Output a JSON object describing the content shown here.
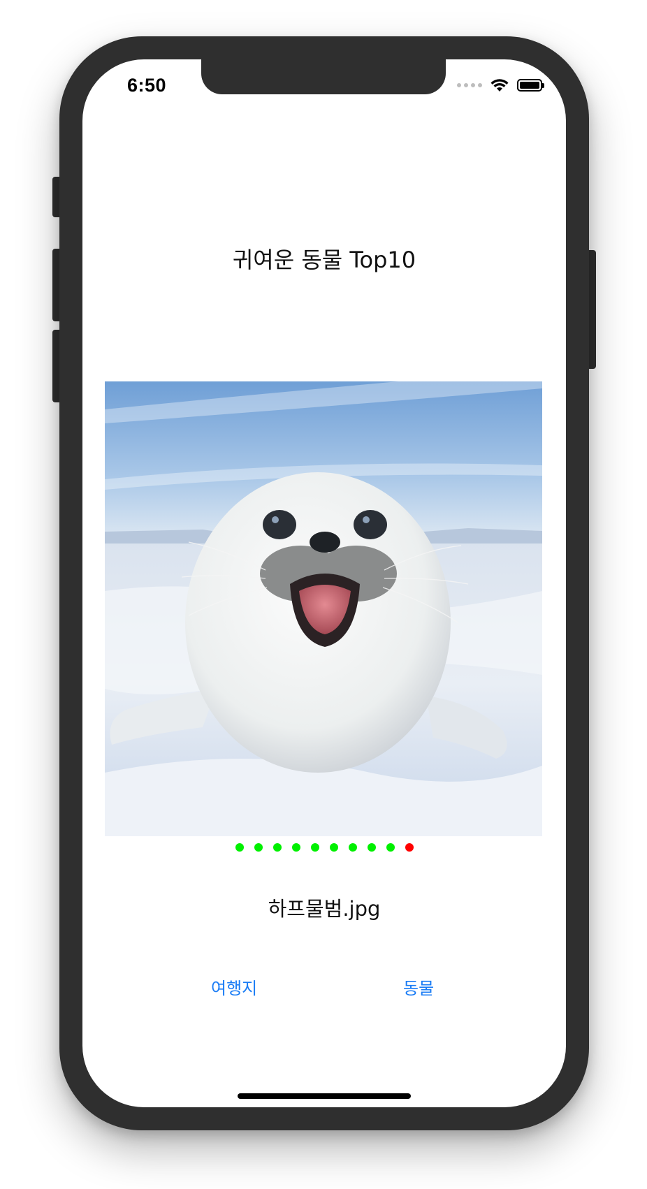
{
  "status_bar": {
    "time": "6:50",
    "icons": [
      "cellular-signal-icon",
      "wifi-icon",
      "battery-icon"
    ],
    "battery_level": 1.0
  },
  "page": {
    "title": "귀여운 동물 Top10"
  },
  "gallery": {
    "image_subject": "harp seal pup on snow",
    "filename": "하프물범.jpg",
    "page_count": 10,
    "current_index": 10,
    "active_dot_color": "#ff0000",
    "inactive_dot_color": "#00f000"
  },
  "buttons": {
    "travel_label": "여행지",
    "animal_label": "동물",
    "color": "#1a7cf5"
  }
}
